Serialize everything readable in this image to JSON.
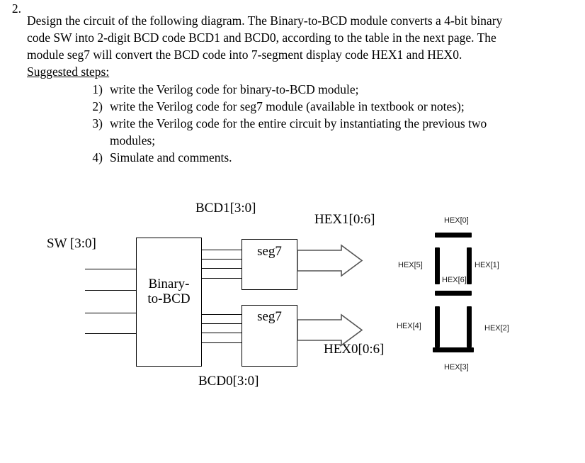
{
  "question": {
    "number": "2.",
    "paragraph": "Design the circuit of the following diagram. The Binary-to-BCD module converts a 4-bit binary code SW into 2-digit BCD code BCD1 and BCD0, according to the table in the next page. The module seg7 will convert the BCD code into 7-segment display code HEX1 and HEX0.",
    "steps_heading": "Suggested steps:",
    "steps": [
      {
        "marker": "1)",
        "text": "write the Verilog code for binary-to-BCD module;"
      },
      {
        "marker": "2)",
        "text": "write the Verilog code for seg7 module (available in textbook or notes);"
      },
      {
        "marker": "3)",
        "text": "write the Verilog code for the entire circuit by instantiating the previous two modules;"
      },
      {
        "marker": "4)",
        "text": "Simulate and comments."
      }
    ]
  },
  "diagram": {
    "input_label": "SW [3:0]",
    "binary_to_bcd_line1": "Binary-",
    "binary_to_bcd_line2": "to-BCD",
    "seg7_top_label": "seg7",
    "seg7_bottom_label": "seg7",
    "bcd1_label": "BCD1[3:0]",
    "bcd0_label": "BCD0[3:0]",
    "hex1_label": "HEX1[0:6]",
    "hex0_label": "HEX0[0:6]",
    "seven_segment": {
      "top": "HEX[0]",
      "top_right": "HEX[1]",
      "bottom_right": "HEX[2]",
      "bottom": "HEX[3]",
      "bottom_left": "HEX[4]",
      "top_left": "HEX[5]",
      "middle": "HEX[6]"
    },
    "colors": {
      "line": "#000000",
      "arrow_outline": "#555555",
      "segment_fill": "#000000",
      "background": "#ffffff"
    }
  }
}
